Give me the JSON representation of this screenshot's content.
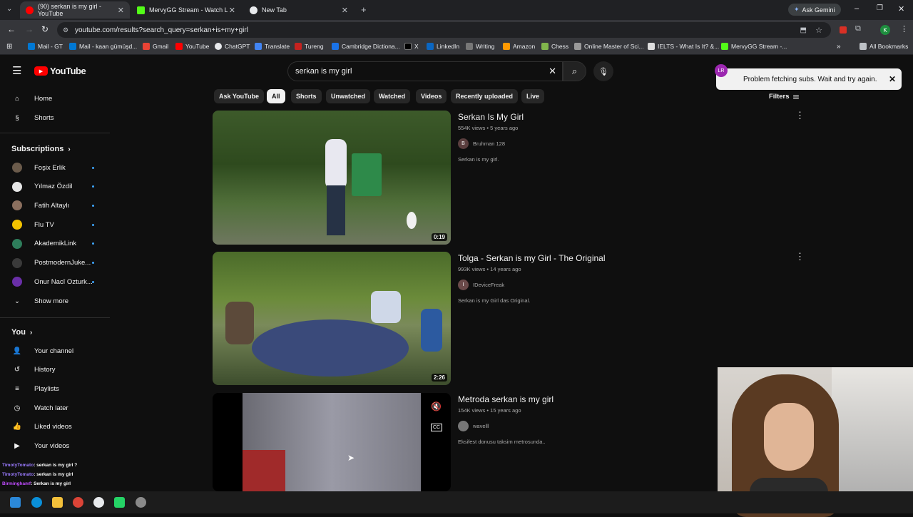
{
  "tabs": [
    {
      "title": "(90) serkan is my girl - YouTube",
      "active": true
    },
    {
      "title": "MervyGG Stream - Watch Live o",
      "active": false
    },
    {
      "title": "New Tab",
      "active": false
    }
  ],
  "gemini_label": "Ask Gemini",
  "url": "youtube.com/results?search_query=serkan+is+my+girl",
  "bookmarks": [
    "Mail - GT",
    "Mail - kaan gümüşd...",
    "Gmail",
    "YouTube",
    "ChatGPT",
    "Translate",
    "Tureng",
    "Cambridge Dictiona...",
    "X",
    "LinkedIn",
    "Writing",
    "Amazon",
    "Chess",
    "Online Master of Sci...",
    "IELTS - What Is It? &...",
    "MervyGG Stream -..."
  ],
  "all_bookmarks": "All Bookmarks",
  "youtube": {
    "logo": "YouTube",
    "search_value": "serkan is my girl"
  },
  "sidebar": {
    "main": [
      {
        "label": "Home",
        "icon": "home-icon"
      },
      {
        "label": "Shorts",
        "icon": "shorts-icon"
      }
    ],
    "subscriptions_title": "Subscriptions",
    "subscriptions": [
      {
        "label": "Foşix Erlik",
        "color": "#6b5b4b"
      },
      {
        "label": "Yılmaz Özdil",
        "color": "#e6e6e6"
      },
      {
        "label": "Fatih Altaylı",
        "color": "#8b6f5e"
      },
      {
        "label": "Flu TV",
        "color": "#f2c200"
      },
      {
        "label": "AkademikLink",
        "color": "#2e7d5b"
      },
      {
        "label": "PostmodernJuke...",
        "color": "#3a3a3a"
      },
      {
        "label": "Onur Nacî Ozturk...",
        "color": "#6a2fa8"
      }
    ],
    "show_more": "Show more",
    "you_title": "You",
    "you_items": [
      {
        "label": "Your channel",
        "icon": "channel-icon"
      },
      {
        "label": "History",
        "icon": "history-icon"
      },
      {
        "label": "Playlists",
        "icon": "playlists-icon"
      },
      {
        "label": "Watch later",
        "icon": "watch-later-icon"
      },
      {
        "label": "Liked videos",
        "icon": "liked-icon"
      },
      {
        "label": "Your videos",
        "icon": "your-videos-icon"
      }
    ]
  },
  "chips": [
    "Ask YouTube",
    "All",
    "Shorts",
    "Unwatched",
    "Watched",
    "Videos",
    "Recently uploaded",
    "Live"
  ],
  "filters": "Filters",
  "toast": "Problem fetching subs. Wait and try again.",
  "videos": [
    {
      "title": "Serkan Is My Girl",
      "meta": "554K views • 5 years ago",
      "channel": "Bruhman 128",
      "avatar": "B",
      "desc": "Serkan is my girl.",
      "duration": "0:19"
    },
    {
      "title": "Tolga - Serkan is my Girl - The Original",
      "meta": "993K views • 14 years ago",
      "channel": "IDeviceFreak",
      "avatar": "I",
      "desc": "Serkan is my Girl das Original.",
      "duration": "2:26"
    },
    {
      "title": "Metroda serkan is my girl",
      "meta": "154K views • 15 years ago",
      "channel": "wavelll",
      "avatar": "",
      "desc": "Eksifest donusu taksim metrosunda..",
      "duration": ""
    }
  ],
  "chat": [
    {
      "user": "TimotyTomato",
      "msg": ": serkan is my girl ?",
      "color": "#9b7bff"
    },
    {
      "user": "TimotyTomato",
      "msg": ": serkan is my girl",
      "color": "#9b7bff"
    },
    {
      "user": "Birminghamf",
      "msg": ": Serkan is my girl",
      "color": "#c04cff"
    }
  ]
}
